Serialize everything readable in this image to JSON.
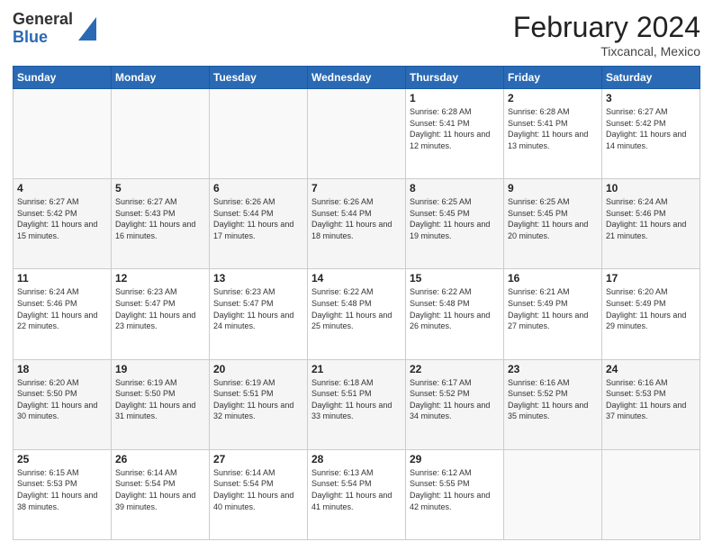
{
  "header": {
    "logo_general": "General",
    "logo_blue": "Blue",
    "month_title": "February 2024",
    "location": "Tixcancal, Mexico"
  },
  "days_of_week": [
    "Sunday",
    "Monday",
    "Tuesday",
    "Wednesday",
    "Thursday",
    "Friday",
    "Saturday"
  ],
  "weeks": [
    [
      {
        "day": "",
        "info": ""
      },
      {
        "day": "",
        "info": ""
      },
      {
        "day": "",
        "info": ""
      },
      {
        "day": "",
        "info": ""
      },
      {
        "day": "1",
        "info": "Sunrise: 6:28 AM\nSunset: 5:41 PM\nDaylight: 11 hours and 12 minutes."
      },
      {
        "day": "2",
        "info": "Sunrise: 6:28 AM\nSunset: 5:41 PM\nDaylight: 11 hours and 13 minutes."
      },
      {
        "day": "3",
        "info": "Sunrise: 6:27 AM\nSunset: 5:42 PM\nDaylight: 11 hours and 14 minutes."
      }
    ],
    [
      {
        "day": "4",
        "info": "Sunrise: 6:27 AM\nSunset: 5:42 PM\nDaylight: 11 hours and 15 minutes."
      },
      {
        "day": "5",
        "info": "Sunrise: 6:27 AM\nSunset: 5:43 PM\nDaylight: 11 hours and 16 minutes."
      },
      {
        "day": "6",
        "info": "Sunrise: 6:26 AM\nSunset: 5:44 PM\nDaylight: 11 hours and 17 minutes."
      },
      {
        "day": "7",
        "info": "Sunrise: 6:26 AM\nSunset: 5:44 PM\nDaylight: 11 hours and 18 minutes."
      },
      {
        "day": "8",
        "info": "Sunrise: 6:25 AM\nSunset: 5:45 PM\nDaylight: 11 hours and 19 minutes."
      },
      {
        "day": "9",
        "info": "Sunrise: 6:25 AM\nSunset: 5:45 PM\nDaylight: 11 hours and 20 minutes."
      },
      {
        "day": "10",
        "info": "Sunrise: 6:24 AM\nSunset: 5:46 PM\nDaylight: 11 hours and 21 minutes."
      }
    ],
    [
      {
        "day": "11",
        "info": "Sunrise: 6:24 AM\nSunset: 5:46 PM\nDaylight: 11 hours and 22 minutes."
      },
      {
        "day": "12",
        "info": "Sunrise: 6:23 AM\nSunset: 5:47 PM\nDaylight: 11 hours and 23 minutes."
      },
      {
        "day": "13",
        "info": "Sunrise: 6:23 AM\nSunset: 5:47 PM\nDaylight: 11 hours and 24 minutes."
      },
      {
        "day": "14",
        "info": "Sunrise: 6:22 AM\nSunset: 5:48 PM\nDaylight: 11 hours and 25 minutes."
      },
      {
        "day": "15",
        "info": "Sunrise: 6:22 AM\nSunset: 5:48 PM\nDaylight: 11 hours and 26 minutes."
      },
      {
        "day": "16",
        "info": "Sunrise: 6:21 AM\nSunset: 5:49 PM\nDaylight: 11 hours and 27 minutes."
      },
      {
        "day": "17",
        "info": "Sunrise: 6:20 AM\nSunset: 5:49 PM\nDaylight: 11 hours and 29 minutes."
      }
    ],
    [
      {
        "day": "18",
        "info": "Sunrise: 6:20 AM\nSunset: 5:50 PM\nDaylight: 11 hours and 30 minutes."
      },
      {
        "day": "19",
        "info": "Sunrise: 6:19 AM\nSunset: 5:50 PM\nDaylight: 11 hours and 31 minutes."
      },
      {
        "day": "20",
        "info": "Sunrise: 6:19 AM\nSunset: 5:51 PM\nDaylight: 11 hours and 32 minutes."
      },
      {
        "day": "21",
        "info": "Sunrise: 6:18 AM\nSunset: 5:51 PM\nDaylight: 11 hours and 33 minutes."
      },
      {
        "day": "22",
        "info": "Sunrise: 6:17 AM\nSunset: 5:52 PM\nDaylight: 11 hours and 34 minutes."
      },
      {
        "day": "23",
        "info": "Sunrise: 6:16 AM\nSunset: 5:52 PM\nDaylight: 11 hours and 35 minutes."
      },
      {
        "day": "24",
        "info": "Sunrise: 6:16 AM\nSunset: 5:53 PM\nDaylight: 11 hours and 37 minutes."
      }
    ],
    [
      {
        "day": "25",
        "info": "Sunrise: 6:15 AM\nSunset: 5:53 PM\nDaylight: 11 hours and 38 minutes."
      },
      {
        "day": "26",
        "info": "Sunrise: 6:14 AM\nSunset: 5:54 PM\nDaylight: 11 hours and 39 minutes."
      },
      {
        "day": "27",
        "info": "Sunrise: 6:14 AM\nSunset: 5:54 PM\nDaylight: 11 hours and 40 minutes."
      },
      {
        "day": "28",
        "info": "Sunrise: 6:13 AM\nSunset: 5:54 PM\nDaylight: 11 hours and 41 minutes."
      },
      {
        "day": "29",
        "info": "Sunrise: 6:12 AM\nSunset: 5:55 PM\nDaylight: 11 hours and 42 minutes."
      },
      {
        "day": "",
        "info": ""
      },
      {
        "day": "",
        "info": ""
      }
    ]
  ]
}
